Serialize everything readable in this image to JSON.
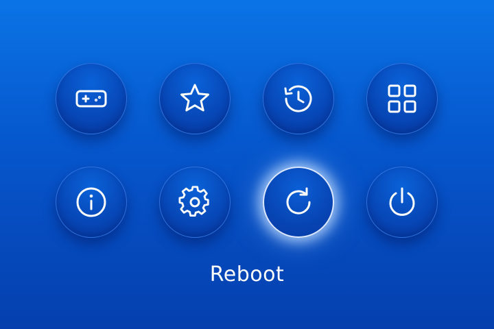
{
  "colors": {
    "background_top": "#0a74e6",
    "background_bottom": "#053fae",
    "icon_stroke": "#ffffff",
    "selection_glow": "#dfe9ff"
  },
  "menu": {
    "items": [
      {
        "id": "games",
        "icon": "gamepad-icon"
      },
      {
        "id": "favorites",
        "icon": "star-icon"
      },
      {
        "id": "history",
        "icon": "history-icon"
      },
      {
        "id": "apps",
        "icon": "grid-icon"
      },
      {
        "id": "info",
        "icon": "info-icon"
      },
      {
        "id": "settings",
        "icon": "gear-icon"
      },
      {
        "id": "reboot",
        "icon": "reboot-icon",
        "selected": true
      },
      {
        "id": "power",
        "icon": "power-icon"
      }
    ],
    "selected_label": "Reboot"
  }
}
